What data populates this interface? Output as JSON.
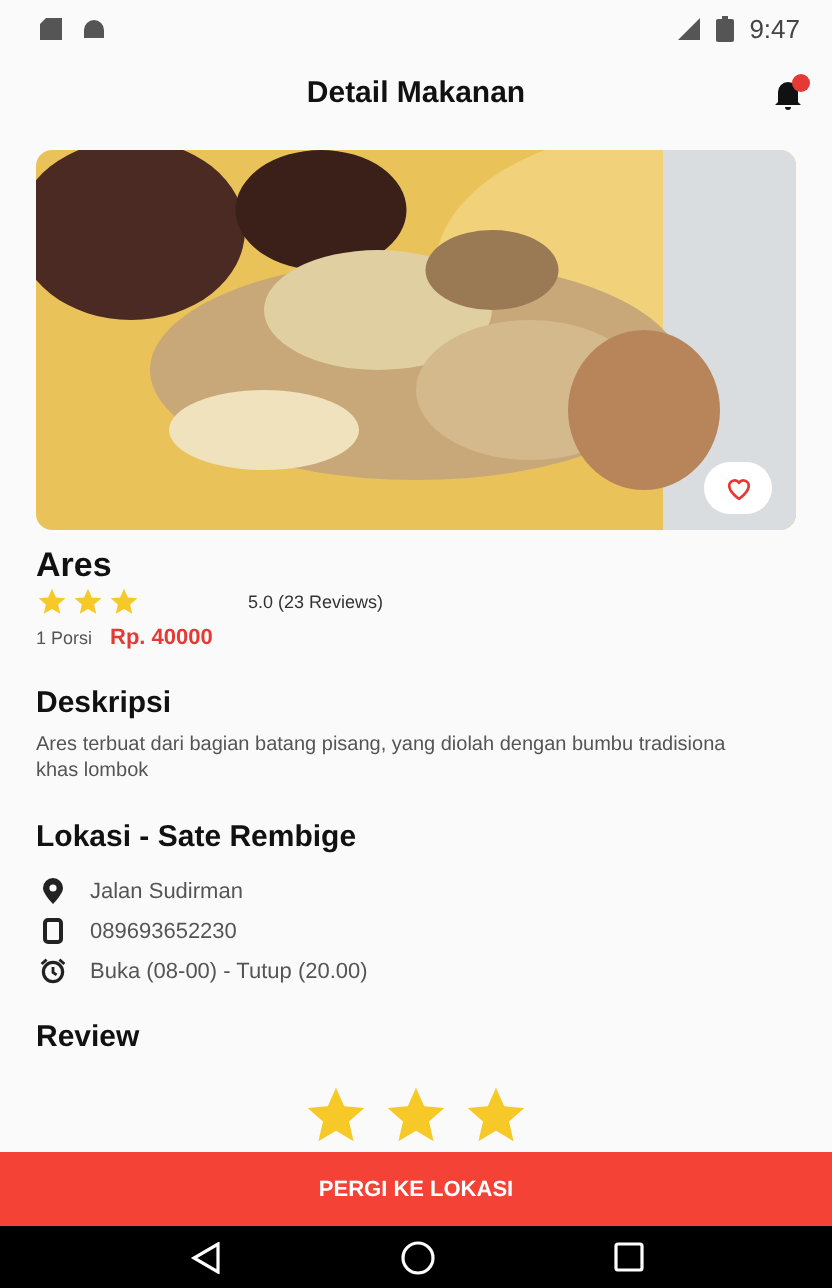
{
  "status_bar": {
    "time": "9:47"
  },
  "app_bar": {
    "title": "Detail Makanan",
    "notification_badge": true
  },
  "food": {
    "favorite": false,
    "name": "Ares",
    "stars": 3,
    "rating": "5.0 (23 Reviews)",
    "portion": "1 Porsi",
    "price": "Rp. 40000"
  },
  "description": {
    "heading": "Deskripsi",
    "text": "Ares terbuat dari bagian batang pisang, yang diolah dengan bumbu tradisiona khas lombok"
  },
  "location": {
    "heading": "Lokasi - Sate Rembige",
    "items": [
      {
        "kind": "address",
        "text": "Jalan Sudirman"
      },
      {
        "kind": "phone",
        "text": "089693652230"
      },
      {
        "kind": "hours",
        "text": "Buka (08-00) - Tutup (20.00)"
      }
    ]
  },
  "review": {
    "heading": "Review",
    "stars": 3
  },
  "action_button": {
    "label": "PERGI KE LOKASI"
  }
}
